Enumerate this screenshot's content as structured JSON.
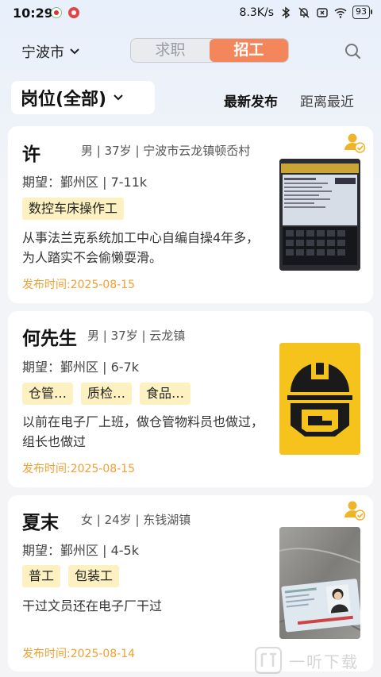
{
  "status_bar": {
    "time": "10:29",
    "network_speed": "8.3K/s",
    "battery": "93"
  },
  "header": {
    "city": "宁波市",
    "tabs": [
      {
        "label": "求职",
        "active": false
      },
      {
        "label": "招工",
        "active": true
      }
    ],
    "search_icon": "search-icon"
  },
  "filter": {
    "position_label": "岗位(全部)",
    "sort_latest": "最新发布",
    "sort_nearest": "距离最近"
  },
  "cards": [
    {
      "name": "许",
      "info": "男 | 37岁 | 宁波市云龙镇顿岙村",
      "expect": "期望：鄞州区 | 7-11k",
      "tags": [
        "数控车床操作工"
      ],
      "desc": "从事法兰克系统加工中心自编自操4年多，为人踏实不会偷懒耍滑。",
      "date": "发布时间:2025-08-15",
      "verified": true,
      "thumb": "cnc-screen-photo"
    },
    {
      "name": "何先生",
      "info": "男 | 37岁 | 云龙镇",
      "expect": "期望：鄞州区 | 6-7k",
      "tags": [
        "仓管…",
        "质检…",
        "食品…"
      ],
      "desc": "以前在电子厂上班，做仓管物料员也做过，组长也做过",
      "date": "发布时间:2025-08-15",
      "verified": false,
      "thumb": "helmet-logo"
    },
    {
      "name": "夏末",
      "info": "女 | 24岁 | 东钱湖镇",
      "expect": "期望：鄞州区 | 4-5k",
      "tags": [
        "普工",
        "包装工"
      ],
      "desc": "干过文员还在电子厂干过",
      "date": "发布时间:2025-08-14",
      "verified": true,
      "thumb": "id-card-photo"
    }
  ],
  "watermark": {
    "text": "一听下载"
  },
  "colors": {
    "accent": "#f3875b",
    "tag_bg": "#fdf1c2",
    "date": "#f0a033",
    "verify": "#f0b429"
  }
}
